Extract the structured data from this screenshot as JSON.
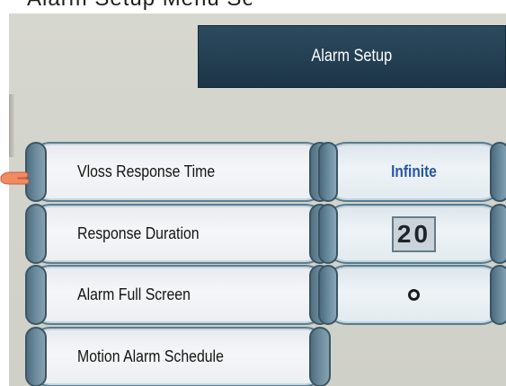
{
  "top_partial_text": "Alarm Setup Menu Setup",
  "title": "Alarm Setup",
  "rows": [
    {
      "label": "Vloss Response Time",
      "value": "Infinite",
      "value_style": "blue-text"
    },
    {
      "label": "Response Duration",
      "value": "20",
      "value_style": "digit-box"
    },
    {
      "label": "Alarm Full Screen",
      "value": "O",
      "value_style": "circle"
    },
    {
      "label": "Motion Alarm Schedule"
    }
  ],
  "colors": {
    "title_bar": "#1d3547",
    "panel_bg": "#d6d7cf",
    "value_blue": "#2755a2",
    "button_border": "#5c7e91"
  },
  "icons": {
    "selection_pointer": "hand-pointer-icon"
  }
}
